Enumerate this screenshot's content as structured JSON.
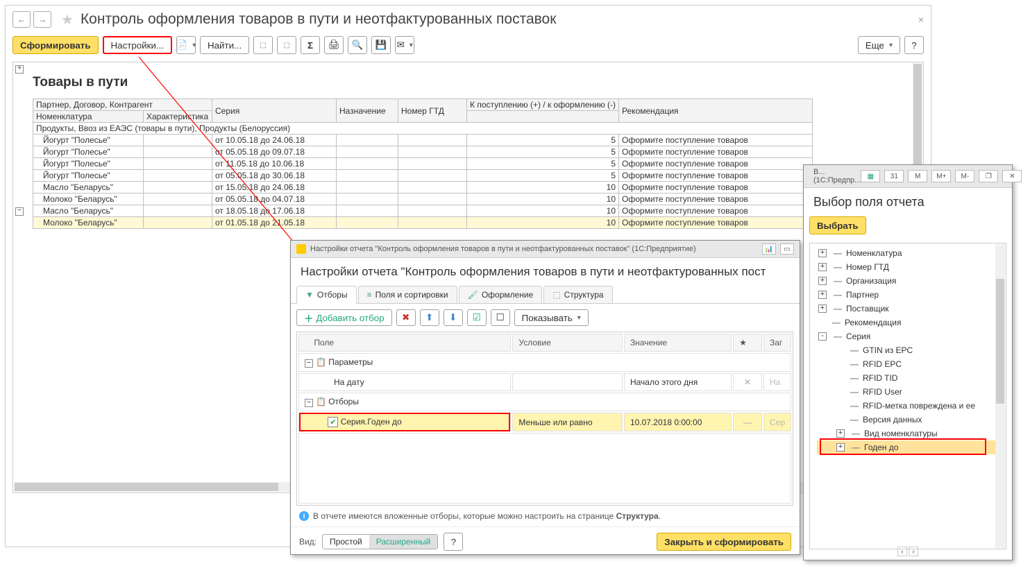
{
  "page_title": "Контроль оформления товаров в пути и неотфактурованных поставок",
  "toolbar": {
    "generate": "Сформировать",
    "settings": "Настройки...",
    "find": "Найти...",
    "more": "Еще"
  },
  "report_title": "Товары в пути",
  "headers": {
    "partner": "Партнер, Договор, Контрагент",
    "item": "Номенклатура",
    "char": "Характеристика",
    "series": "Серия",
    "purpose": "Назначение",
    "gtd": "Номер ГТД",
    "income": "К поступлению (+) / к оформлению (-)",
    "recom": "Рекомендация"
  },
  "group_row": "Продукты, Ввоз из ЕАЭС (товары в пути), Продукты (Белоруссия)",
  "rows": [
    {
      "name": "Йогурт \"Полесье\"",
      "series": "от 10.05.18 до 24.06.18",
      "qty": "5",
      "recom": "Оформите поступление товаров"
    },
    {
      "name": "Йогурт \"Полесье\"",
      "series": "от 05.05.18 до 09.07.18",
      "qty": "5",
      "recom": "Оформите поступление товаров"
    },
    {
      "name": "Йогурт \"Полесье\"",
      "series": "от 11.05.18 до 10.06.18",
      "qty": "5",
      "recom": "Оформите поступление товаров"
    },
    {
      "name": "Йогурт \"Полесье\"",
      "series": "от 05.05.18 до 30.06.18",
      "qty": "5",
      "recom": "Оформите поступление товаров"
    },
    {
      "name": "Масло \"Беларусь\"",
      "series": "от 15.05.18 до 24.06.18",
      "qty": "10",
      "recom": "Оформите поступление товаров"
    },
    {
      "name": "Молоко \"Беларусь\"",
      "series": "от 05.05.18 до 04.07.18",
      "qty": "10",
      "recom": "Оформите поступление товаров"
    },
    {
      "name": "Масло \"Беларусь\"",
      "series": "от 18.05.18 до 17.06.18",
      "qty": "10",
      "recom": "Оформите поступление товаров"
    },
    {
      "name": "Молоко \"Беларусь\"",
      "series": "от 01.05.18 до 21.05.18",
      "qty": "10",
      "recom": "Оформите поступление товаров"
    }
  ],
  "settings_dlg": {
    "titlebar": "Настройки отчета \"Контроль оформления товаров в пути и неотфактурованных поставок\"  (1С:Предприятие)",
    "header": "Настройки отчета \"Контроль оформления товаров в пути и неотфактурованных пост",
    "tabs": {
      "filters": "Отборы",
      "fields": "Поля и сортировки",
      "format": "Оформление",
      "structure": "Структура"
    },
    "add": "Добавить отбор",
    "show": "Показывать",
    "cols": {
      "field": "Поле",
      "cond": "Условие",
      "val": "Значение",
      "title": "Заг"
    },
    "params": "Параметры",
    "on_date": "На дату",
    "on_date_val": "Начало этого дня",
    "on_date_title": "На",
    "filters": "Отборы",
    "sel_field": "Серия.Годен до",
    "sel_cond": "Меньше или равно",
    "sel_val": "10.07.2018 0:00:00",
    "sel_title": "Сер",
    "note_pre": "В отчете имеются вложенные отборы, которые можно настроить на странице ",
    "note_bold": "Структура",
    "view": "Вид:",
    "simple": "Простой",
    "extended": "Расширенный",
    "close_gen": "Закрыть и сформировать"
  },
  "field_dlg": {
    "titlebar_short": "В...  (1С:Предпр...",
    "header": "Выбор поля отчета",
    "choose": "Выбрать",
    "items": [
      {
        "lvl": 0,
        "exp": "+",
        "label": "Номенклатура"
      },
      {
        "lvl": 0,
        "exp": "+",
        "label": "Номер ГТД"
      },
      {
        "lvl": 0,
        "exp": "+",
        "label": "Организация"
      },
      {
        "lvl": 0,
        "exp": "+",
        "label": "Партнер"
      },
      {
        "lvl": 0,
        "exp": "+",
        "label": "Поставщик"
      },
      {
        "lvl": 0,
        "exp": "",
        "label": "Рекомендация"
      },
      {
        "lvl": 0,
        "exp": "-",
        "label": "Серия"
      },
      {
        "lvl": 1,
        "exp": "",
        "label": "GTIN из EPC"
      },
      {
        "lvl": 1,
        "exp": "",
        "label": "RFID EPC"
      },
      {
        "lvl": 1,
        "exp": "",
        "label": "RFID TID"
      },
      {
        "lvl": 1,
        "exp": "",
        "label": "RFID User"
      },
      {
        "lvl": 1,
        "exp": "",
        "label": "RFID-метка повреждена и ее"
      },
      {
        "lvl": 1,
        "exp": "",
        "label": "Версия данных"
      },
      {
        "lvl": 1,
        "exp": "+",
        "label": "Вид номенклатуры"
      },
      {
        "lvl": 1,
        "exp": "+",
        "label": "Годен до",
        "sel": true
      }
    ]
  }
}
